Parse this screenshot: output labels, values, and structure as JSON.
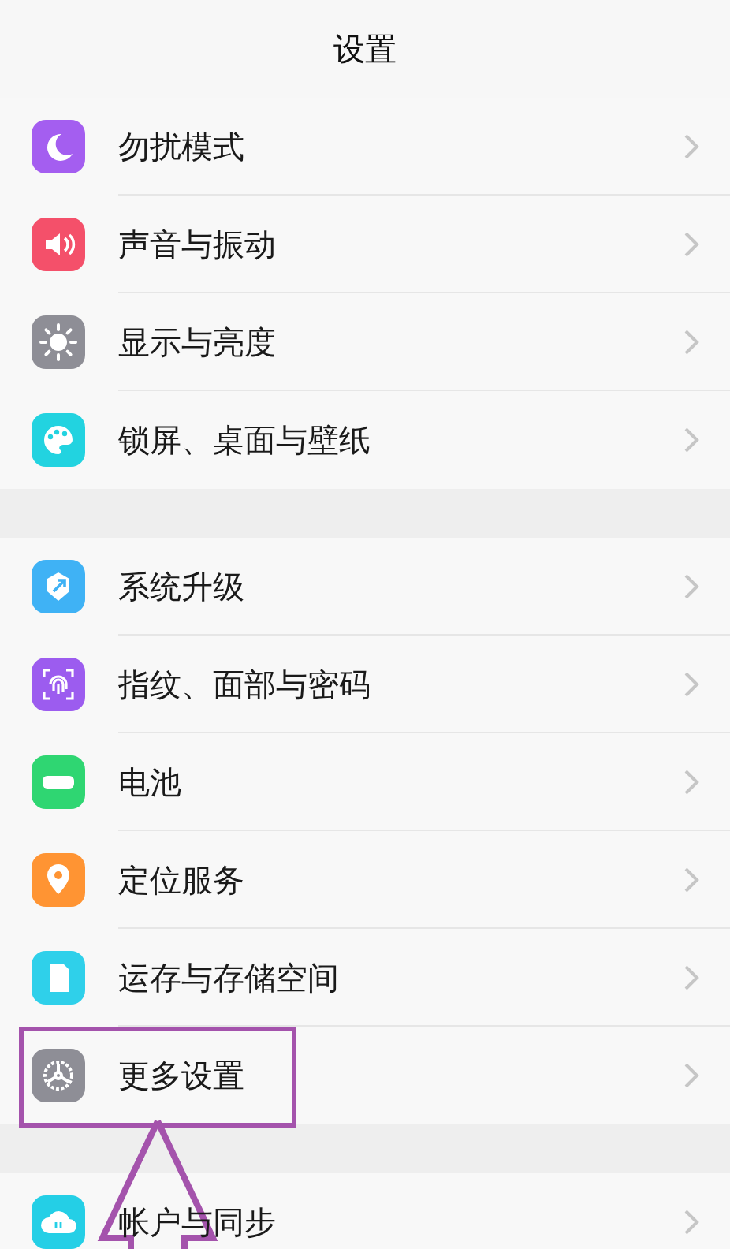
{
  "header": {
    "title": "设置"
  },
  "groups": [
    {
      "items": [
        {
          "label": "勿扰模式",
          "kind": "moon",
          "color": "#a45ef0",
          "annotated": false
        },
        {
          "label": "声音与振动",
          "kind": "speaker",
          "color": "#f4506a",
          "annotated": false
        },
        {
          "label": "显示与亮度",
          "kind": "sun",
          "color": "#8e8e96",
          "annotated": false
        },
        {
          "label": "锁屏、桌面与壁纸",
          "kind": "palette",
          "color": "#22d3e0",
          "annotated": false
        }
      ]
    },
    {
      "items": [
        {
          "label": "系统升级",
          "kind": "upgrade",
          "color": "#3fb2f5",
          "annotated": false
        },
        {
          "label": "指纹、面部与密码",
          "kind": "fingerprint",
          "color": "#9c5cef",
          "annotated": false
        },
        {
          "label": "电池",
          "kind": "battery",
          "color": "#2fd672",
          "annotated": false
        },
        {
          "label": "定位服务",
          "kind": "location",
          "color": "#ff9433",
          "annotated": false
        },
        {
          "label": "运存与存储空间",
          "kind": "card",
          "color": "#2fd0ea",
          "annotated": false
        },
        {
          "label": "更多设置",
          "kind": "gear",
          "color": "#8e8e96",
          "annotated": true
        }
      ]
    },
    {
      "items": [
        {
          "label": "帐户与同步",
          "kind": "cloud",
          "color": "#24cfe6",
          "annotated": false
        }
      ]
    }
  ]
}
